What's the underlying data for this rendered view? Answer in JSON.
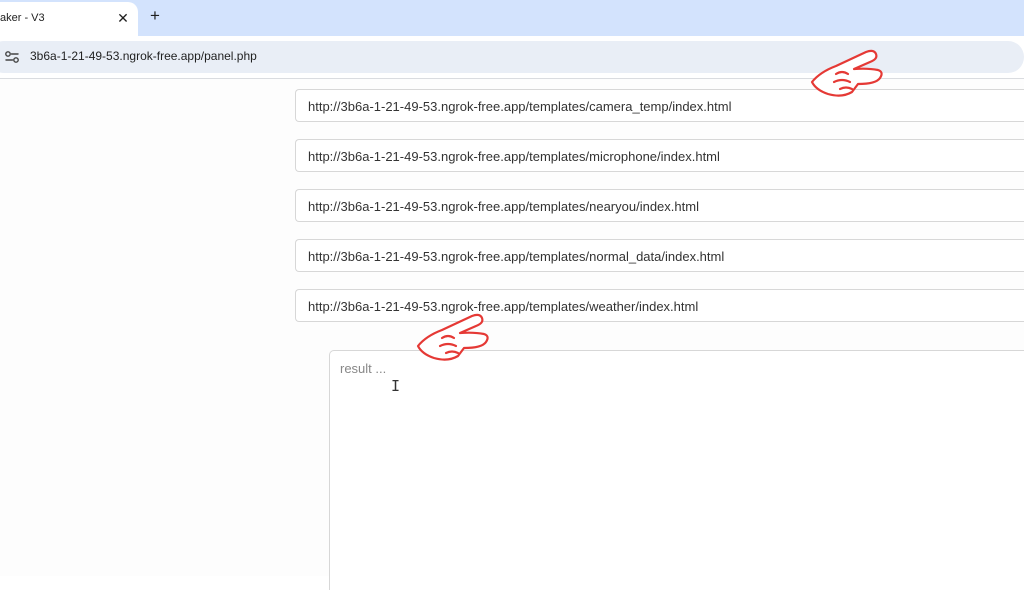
{
  "browser": {
    "tab_title": "aker - V3",
    "close_glyph": "✕",
    "new_tab_glyph": "+",
    "address": "3b6a-1-21-49-53.ngrok-free.app/panel.php",
    "icons": [
      "close-icon",
      "plus-icon",
      "site-info-icon"
    ]
  },
  "links": [
    "http://3b6a-1-21-49-53.ngrok-free.app/templates/camera_temp/index.html",
    "http://3b6a-1-21-49-53.ngrok-free.app/templates/microphone/index.html",
    "http://3b6a-1-21-49-53.ngrok-free.app/templates/nearyou/index.html",
    "http://3b6a-1-21-49-53.ngrok-free.app/templates/normal_data/index.html",
    "http://3b6a-1-21-49-53.ngrok-free.app/templates/weather/index.html"
  ],
  "result": {
    "placeholder": "result ...",
    "cursor_glyph": "I"
  },
  "annotation_color": "#e53935"
}
